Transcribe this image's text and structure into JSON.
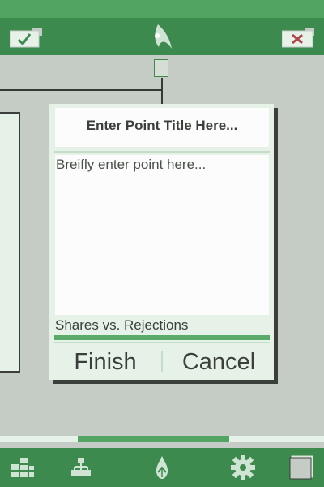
{
  "icons": {
    "confirm": "check-icon",
    "logo": "app-logo-icon",
    "close": "close-icon",
    "nav_grid": "grid-icon",
    "nav_tree": "hierarchy-icon",
    "nav_logo": "app-logo-icon",
    "nav_settings": "gear-icon",
    "nav_window": "window-icon"
  },
  "dialog": {
    "title_placeholder": "Enter Point Title Here...",
    "body_placeholder": "Breifly enter point here...",
    "shares_label": "Shares vs. Rejections",
    "shares_ratio": 1.0,
    "finish_label": "Finish",
    "cancel_label": "Cancel"
  },
  "progress": {
    "start": 0.24,
    "end": 0.7075
  },
  "colors": {
    "primary": "#3d8a4e",
    "accent": "#52a462",
    "background": "#c5ccc6",
    "panel": "#e6f2e8",
    "close_x": "#b0464a"
  }
}
